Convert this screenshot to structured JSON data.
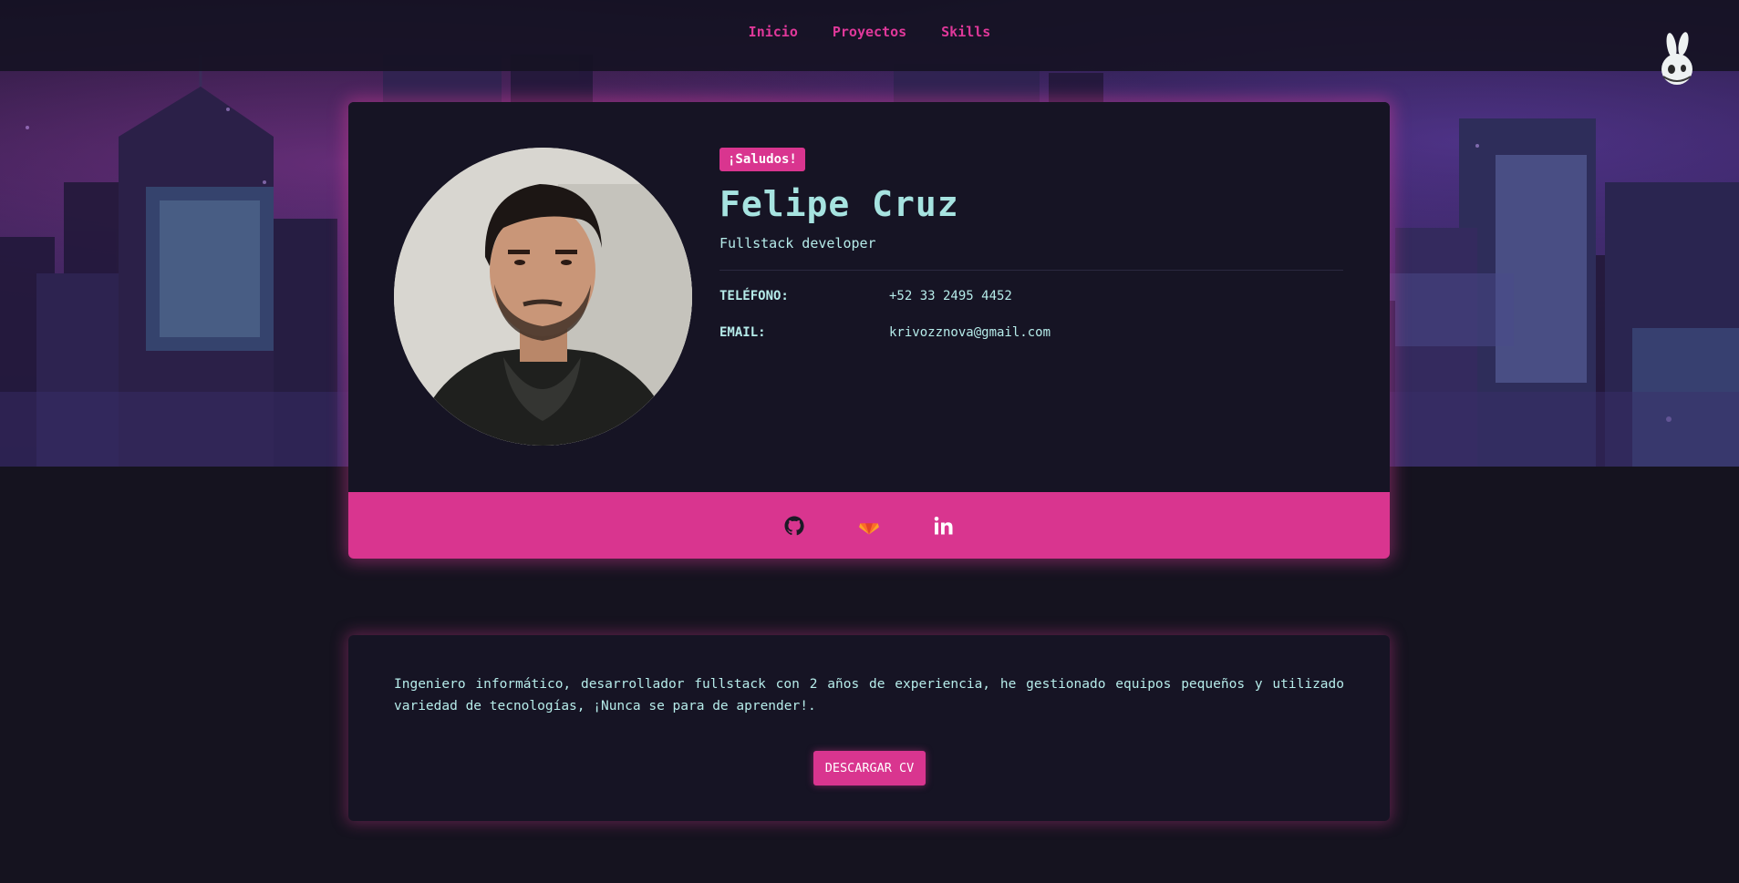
{
  "nav": {
    "links": [
      "Inicio",
      "Proyectos",
      "Skills"
    ]
  },
  "profile": {
    "badge": "¡Saludos!",
    "name": "Felipe Cruz",
    "role": "Fullstack developer",
    "phone_label": "TELÉFONO:",
    "phone": "+52 33 2495 4452",
    "email_label": "EMAIL:",
    "email": "krivozznova@gmail.com"
  },
  "social": {
    "icons": [
      "github-icon",
      "gitlab-icon",
      "linkedin-icon"
    ]
  },
  "about": {
    "text": "Ingeniero informático, desarrollador fullstack con 2 años de experiencia, he gestionado equipos pequeños y utilizado variedad de tecnologías, ¡Nunca se para de aprender!.",
    "cv_button": "DESCARGAR CV"
  },
  "colors": {
    "accent": "#d9358f",
    "text": "#b6ecea",
    "background": "#15131f",
    "card": "#161424"
  }
}
